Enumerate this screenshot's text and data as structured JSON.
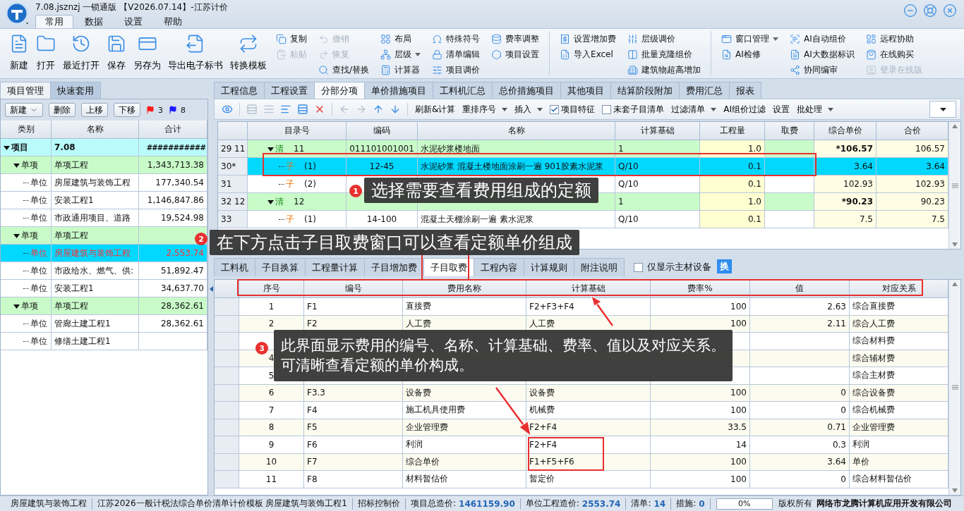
{
  "window": {
    "title": "7.08.jsznzj 一锁通版 【V2026.07.14】-江苏计价"
  },
  "menu_tabs": [
    {
      "label": "常用",
      "selected": true
    },
    {
      "label": "数据",
      "selected": false
    },
    {
      "label": "设置",
      "selected": false
    },
    {
      "label": "帮助",
      "selected": false
    }
  ],
  "ribbon": {
    "large_buttons": [
      {
        "label": "新建"
      },
      {
        "label": "打开"
      },
      {
        "label": "最近打开"
      },
      {
        "label": "保存"
      },
      {
        "label": "另存为"
      },
      {
        "label": "导出电子标书"
      },
      {
        "label": "转换模板"
      }
    ],
    "groups": [
      [
        [
          {
            "label": "复制",
            "disabled": false,
            "dropdown": false
          },
          {
            "label": "粘贴",
            "disabled": true,
            "dropdown": false
          }
        ],
        [
          {
            "label": "撤销",
            "disabled": true,
            "dropdown": false
          },
          {
            "label": "恢复",
            "disabled": true,
            "dropdown": false
          },
          {
            "label": "查找/替换",
            "disabled": false,
            "dropdown": false
          }
        ],
        [
          {
            "label": "布局",
            "disabled": false,
            "dropdown": false
          },
          {
            "label": "层级",
            "disabled": false,
            "dropdown": true
          },
          {
            "label": "计算器",
            "disabled": false,
            "dropdown": false
          }
        ],
        [
          {
            "label": "特殊符号",
            "disabled": false,
            "dropdown": false
          },
          {
            "label": "清单编辑",
            "disabled": false,
            "dropdown": false
          },
          {
            "label": "项目调价",
            "disabled": false,
            "dropdown": false
          }
        ],
        [
          {
            "label": "费率调整",
            "disabled": false,
            "dropdown": false
          },
          {
            "label": "项目设置",
            "disabled": false,
            "dropdown": false
          }
        ]
      ],
      [
        [
          {
            "label": "设置增加费",
            "disabled": false,
            "dropdown": false
          },
          {
            "label": "导入Excel",
            "disabled": false,
            "dropdown": false
          }
        ],
        [
          {
            "label": "层级调价",
            "disabled": false,
            "dropdown": false
          },
          {
            "label": "批量克隆组价",
            "disabled": false,
            "dropdown": false
          },
          {
            "label": "建筑物超高增加",
            "disabled": false,
            "dropdown": false
          }
        ]
      ],
      [
        [
          {
            "label": "窗口管理",
            "disabled": false,
            "dropdown": true
          },
          {
            "label": "AI检修",
            "disabled": false,
            "dropdown": false
          }
        ],
        [
          {
            "label": "AI自动组价",
            "disabled": false,
            "dropdown": false
          },
          {
            "label": "AI大数据标识",
            "disabled": false,
            "dropdown": false
          },
          {
            "label": "协同编审",
            "disabled": false,
            "dropdown": false
          }
        ],
        [
          {
            "label": "远程协助",
            "disabled": false,
            "dropdown": false
          },
          {
            "label": "在线购买",
            "disabled": false,
            "dropdown": false
          },
          {
            "label": "登录在线版",
            "disabled": true,
            "dropdown": false
          }
        ]
      ]
    ]
  },
  "left_panel": {
    "tabs": [
      {
        "label": "项目管理",
        "selected": true
      },
      {
        "label": "快速套用",
        "selected": false
      }
    ],
    "buttons": [
      {
        "label": "新建",
        "dropdown": true
      },
      {
        "label": "删除",
        "dropdown": false
      },
      {
        "label": "上移",
        "dropdown": false
      },
      {
        "label": "下移",
        "dropdown": false
      }
    ],
    "flags": [
      {
        "count": "3",
        "color": "#ff1a1a"
      },
      {
        "count": "8",
        "color": "#1a1aff"
      }
    ],
    "columns": [
      "类别",
      "名称",
      "合计"
    ],
    "tree": [
      {
        "category": "项目",
        "name": "7.08",
        "total": "###########",
        "expanded": true,
        "selected": false,
        "children": [
          {
            "category": "单项",
            "name": "单项工程",
            "total": "1,343,713.38",
            "expanded": true,
            "selected": false,
            "children": [
              {
                "category": "单位",
                "name": "房屋建筑与装饰工程",
                "total": "177,340.54",
                "selected": false
              },
              {
                "category": "单位",
                "name": "安装工程1",
                "total": "1,146,847.86",
                "selected": false
              },
              {
                "category": "单位",
                "name": "市政通用项目、道路",
                "total": "19,524.98",
                "selected": false
              }
            ]
          },
          {
            "category": "单项",
            "name": "单项工程",
            "expanded": true,
            "selected": false,
            "children": [
              {
                "category": "单位",
                "name": "房屋建筑与装饰工程",
                "total": "2,553.74",
                "selected": true
              },
              {
                "category": "单位",
                "name": "市政给水、燃气、供:",
                "total": "51,892.47",
                "selected": false
              },
              {
                "category": "单位",
                "name": "安装工程1",
                "total": "34,637.70",
                "selected": false
              }
            ]
          },
          {
            "category": "单项",
            "name": "单项工程",
            "total": "28,362.61",
            "expanded": true,
            "selected": false,
            "children": [
              {
                "category": "单位",
                "name": "管廊土建工程1",
                "total": "28,362.61",
                "selected": false
              },
              {
                "category": "单位",
                "name": "修缮土建工程1",
                "selected": false
              }
            ]
          }
        ]
      }
    ]
  },
  "main_tabs": [
    {
      "label": "工程信息",
      "selected": false
    },
    {
      "label": "工程设置",
      "selected": false
    },
    {
      "label": "分部分项",
      "selected": true
    },
    {
      "label": "单价措施项目",
      "selected": false
    },
    {
      "label": "工料机汇总",
      "selected": false
    },
    {
      "label": "总价措施项目",
      "selected": false
    },
    {
      "label": "其他项目",
      "selected": false
    },
    {
      "label": "结算阶段附加",
      "selected": false
    },
    {
      "label": "费用汇总",
      "selected": false
    },
    {
      "label": "报表",
      "selected": false
    }
  ],
  "toolbar": {
    "icon_buttons": [
      {
        "disabled": false
      },
      {
        "disabled": true
      },
      {
        "disabled": true
      },
      {
        "disabled": false
      },
      {
        "disabled": false
      },
      {
        "disabled": false
      },
      {
        "disabled": true
      },
      {
        "disabled": true
      },
      {
        "disabled": false
      },
      {
        "disabled": false
      }
    ],
    "items": [
      {
        "kind": "button",
        "label": "刷新&计算"
      },
      {
        "kind": "dropdown",
        "label": "重排序号"
      },
      {
        "kind": "dropdown",
        "label": "插入"
      },
      {
        "kind": "checkbox",
        "label": "项目特征",
        "checked": true
      },
      {
        "kind": "checkbox",
        "label": "未套子目清单",
        "checked": false
      },
      {
        "kind": "dropdown",
        "label": "过滤清单"
      },
      {
        "kind": "button",
        "label": "AI组价过滤"
      },
      {
        "kind": "button",
        "label": "设置"
      },
      {
        "kind": "dropdown",
        "label": "批处理"
      }
    ]
  },
  "items_table": {
    "columns": [
      "目录号",
      "编码",
      "名称",
      "计算基础",
      "工程量",
      "取费",
      "综合单价",
      "合价"
    ],
    "rows": [
      {
        "row_header": "29 11",
        "kind": "bill",
        "type": "清",
        "number": "11",
        "code": "011101001001",
        "name": "水泥砂浆楼地面",
        "basis": "1",
        "quantity": "1.0",
        "unit_price": "*106.57",
        "total": "106.57",
        "expanded": true,
        "selected": false,
        "children": [
          {
            "row_header": "30*",
            "kind": "item",
            "type": "子",
            "number": "(1)",
            "code": "12-45",
            "name": "水泥砂浆 混凝土楼地面涂刷一遍 901胶素水泥浆",
            "basis": "Q/10",
            "quantity": "0.1",
            "unit_price": "3.64",
            "total": "3.64",
            "selected": true
          },
          {
            "row_header": "31",
            "kind": "item",
            "type": "子",
            "number": "(2)",
            "basis": "Q/10",
            "quantity": "0.1",
            "unit_price": "102.93",
            "total": "102.93",
            "selected": false
          }
        ]
      },
      {
        "row_header": "32 12",
        "kind": "bill",
        "type": "清",
        "number": "12",
        "basis": "1",
        "quantity": "1.0",
        "unit_price": "*90.23",
        "total": "90.23",
        "expanded": true,
        "selected": false,
        "children": [
          {
            "row_header": "33",
            "kind": "item",
            "type": "子",
            "number": "(1)",
            "code": "14-100",
            "name": "混凝土天棚涂刷一遍 素水泥浆",
            "basis": "Q/10",
            "quantity": "0.1",
            "unit_price": "7.5",
            "total": "7.5",
            "selected": false
          }
        ]
      }
    ]
  },
  "detail_tabs": [
    {
      "label": "工料机",
      "selected": false
    },
    {
      "label": "子目换算",
      "selected": false
    },
    {
      "label": "工程量计算",
      "selected": false
    },
    {
      "label": "子目增加费",
      "selected": false
    },
    {
      "label": "子目取费",
      "selected": true
    },
    {
      "label": "工程内容",
      "selected": false
    },
    {
      "label": "计算规则",
      "selected": false
    },
    {
      "label": "附注说明",
      "selected": false
    }
  ],
  "main_material_only": {
    "label": "仅显示主材设备",
    "checked": false
  },
  "swap_button": "换",
  "fee_table": {
    "columns": [
      "序号",
      "编号",
      "费用名称",
      "计算基础",
      "费率%",
      "值",
      "对应关系"
    ],
    "rows": [
      {
        "index": "1",
        "code": "F1",
        "name": "直接费",
        "basis": "F2+F3+F4",
        "rate": "100",
        "value": "2.63",
        "relation": "综合直接费"
      },
      {
        "index": "2",
        "code": "F2",
        "name": "人工费",
        "basis": "人工费",
        "rate": "100",
        "value": "2.11",
        "relation": "综合人工费"
      },
      {
        "relation": "综合材料费"
      },
      {
        "index": "4",
        "relation": "综合辅材费"
      },
      {
        "index": "5",
        "relation": "综合主材费"
      },
      {
        "index": "6",
        "code": "F3.3",
        "name": "设备费",
        "basis": "设备费",
        "rate": "100",
        "value": "0",
        "relation": "综合设备费"
      },
      {
        "index": "7",
        "code": "F4",
        "name": "施工机具使用费",
        "basis": "机械费",
        "rate": "100",
        "value": "0",
        "relation": "综合机械费"
      },
      {
        "index": "8",
        "code": "F5",
        "name": "企业管理费",
        "basis": "F2+F4",
        "rate": "33.5",
        "value": "0.71",
        "relation": "企业管理费"
      },
      {
        "index": "9",
        "code": "F6",
        "name": "利润",
        "basis": "F2+F4",
        "rate": "14",
        "value": "0.3",
        "relation": "利润"
      },
      {
        "index": "10",
        "code": "F7",
        "name": "综合单价",
        "basis": "F1+F5+F6",
        "rate": "100",
        "value": "3.64",
        "relation": "单价"
      },
      {
        "index": "11",
        "code": "F8",
        "name": "材料暂估价",
        "basis": "暂定价",
        "rate": "100",
        "value": "0",
        "relation": "综合材料暂估价"
      }
    ]
  },
  "annotations": [
    {
      "badge": "1",
      "lines": [
        "选择需要查看费用组成的定额"
      ]
    },
    {
      "badge": "2",
      "lines": [
        "在下方点击子目取费窗口可以查看定额单价组成"
      ]
    },
    {
      "badge": "3",
      "lines": [
        "此界面显示费用的编号、名称、计算基础、费率、值以及对应关系。",
        "可清晰查看定额的单价构成。"
      ]
    }
  ],
  "status_bar": {
    "segments": [
      {
        "label": "房屋建筑与装饰工程"
      },
      {
        "label": "江苏2026一般计税法综合单价清单计价模板 房屋建筑与装饰工程1"
      },
      {
        "label": "招标控制价"
      },
      {
        "label": "项目总造价:",
        "value": "1461159.90"
      },
      {
        "label": "单位工程造价:",
        "value": "2553.74"
      },
      {
        "label": "清单:",
        "value": "14"
      },
      {
        "label": "措施:",
        "value": "0"
      }
    ],
    "progress": {
      "level": 0,
      "reading": "0%"
    },
    "copyright": "版权所有",
    "company": "网络市龙腾计算机应用开发有限公司"
  }
}
